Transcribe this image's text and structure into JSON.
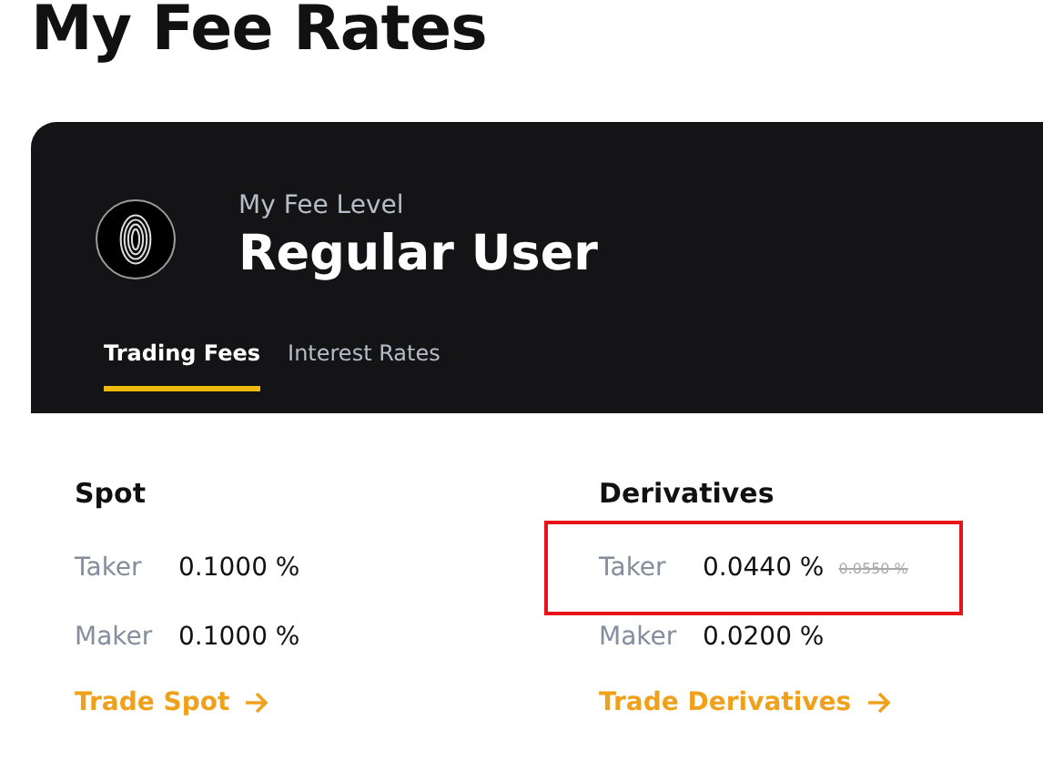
{
  "page_title": "My Fee Rates",
  "fee_level": {
    "label": "My Fee Level",
    "value": "Regular User"
  },
  "tabs": [
    {
      "label": "Trading Fees",
      "selected": true
    },
    {
      "label": "Interest Rates",
      "selected": false
    }
  ],
  "sections": [
    {
      "title": "Spot",
      "rows": [
        {
          "label": "Taker",
          "value": "0.1000 %",
          "highlighted": false
        },
        {
          "label": "Maker",
          "value": "0.1000 %",
          "highlighted": false
        }
      ],
      "link": "Trade Spot"
    },
    {
      "title": "Derivatives",
      "rows": [
        {
          "label": "Taker",
          "value": "0.0440 %",
          "original": "0.0550 %",
          "highlighted": true
        },
        {
          "label": "Maker",
          "value": "0.0200 %",
          "highlighted": false
        }
      ],
      "link": "Trade Derivatives"
    }
  ]
}
